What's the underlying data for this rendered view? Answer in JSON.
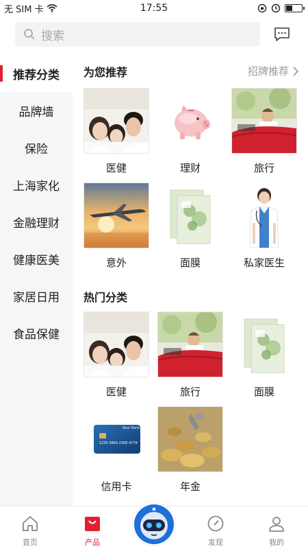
{
  "status_bar": {
    "carrier": "无 SIM 卡",
    "time": "17:55"
  },
  "search": {
    "placeholder": "搜索"
  },
  "sidebar": {
    "items": [
      {
        "label": "推荐分类"
      },
      {
        "label": "品牌墙"
      },
      {
        "label": "保险"
      },
      {
        "label": "上海家化"
      },
      {
        "label": "金融理财"
      },
      {
        "label": "健康医美"
      },
      {
        "label": "家居日用"
      },
      {
        "label": "食品保健"
      }
    ]
  },
  "recommend": {
    "title": "为您推荐",
    "more_label": "招牌推荐",
    "items": [
      {
        "label": "医健",
        "icon": "family-photo"
      },
      {
        "label": "理财",
        "icon": "piggy-bank"
      },
      {
        "label": "旅行",
        "icon": "convertible-car"
      },
      {
        "label": "意外",
        "icon": "airplane"
      },
      {
        "label": "面膜",
        "icon": "face-mask"
      },
      {
        "label": "私家医生",
        "icon": "doctor"
      }
    ]
  },
  "hot": {
    "title": "热门分类",
    "items": [
      {
        "label": "医健",
        "icon": "family-photo"
      },
      {
        "label": "旅行",
        "icon": "convertible-car"
      },
      {
        "label": "面膜",
        "icon": "face-mask"
      },
      {
        "label": "信用卡",
        "icon": "credit-card"
      },
      {
        "label": "年金",
        "icon": "coins"
      }
    ]
  },
  "credit_card": {
    "bank": "Best Bank",
    "number": "1235 5864 2358 4779"
  },
  "tabbar": {
    "items": [
      {
        "label": "首页",
        "icon": "home-icon"
      },
      {
        "label": "产品",
        "icon": "bag-icon"
      },
      {
        "label": "发现",
        "icon": "compass-icon"
      },
      {
        "label": "我的",
        "icon": "user-icon"
      }
    ]
  },
  "colors": {
    "accent": "#e3202f",
    "sidebar_bg": "#f6f6f8",
    "search_bg": "#f3f3f5"
  }
}
